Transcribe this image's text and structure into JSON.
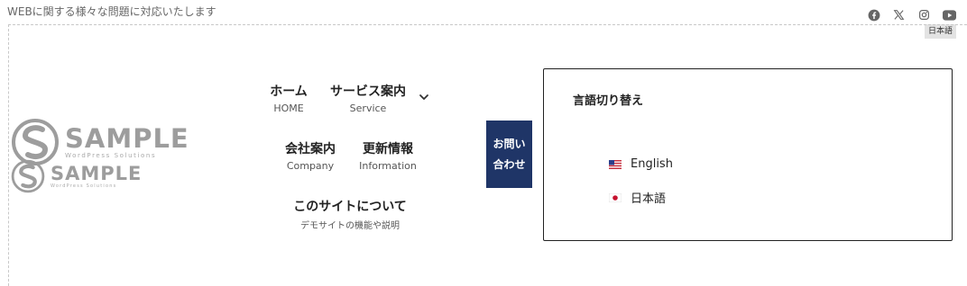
{
  "header": {
    "tagline": "WEBに関する様々な問題に対応いたします",
    "social": [
      "facebook-icon",
      "x-icon",
      "instagram-icon",
      "youtube-icon"
    ],
    "lang_tag": "日本語"
  },
  "logos": [
    {
      "name": "SAMPLE",
      "sub": "WordPress Solutions"
    },
    {
      "name": "SAMPLE",
      "sub": "WordPress Solutions"
    }
  ],
  "nav": {
    "items": [
      {
        "label": "ホーム",
        "sub": "HOME"
      },
      {
        "label": "サービス案内",
        "sub": "Service",
        "has_dropdown": true
      },
      {
        "label": "会社案内",
        "sub": "Company"
      },
      {
        "label": "更新情報",
        "sub": "Information"
      },
      {
        "label": "このサイトについて",
        "sub": "デモサイトの機能や説明"
      }
    ],
    "contact_label": "お問い合わせ"
  },
  "language_switcher": {
    "title": "言語切り替え",
    "options": [
      {
        "label": "English",
        "flag": "us-flag-icon"
      },
      {
        "label": "日本語",
        "flag": "jp-flag-icon"
      }
    ]
  },
  "colors": {
    "accent": "#1f3567",
    "logo": "#9d9d9d"
  }
}
